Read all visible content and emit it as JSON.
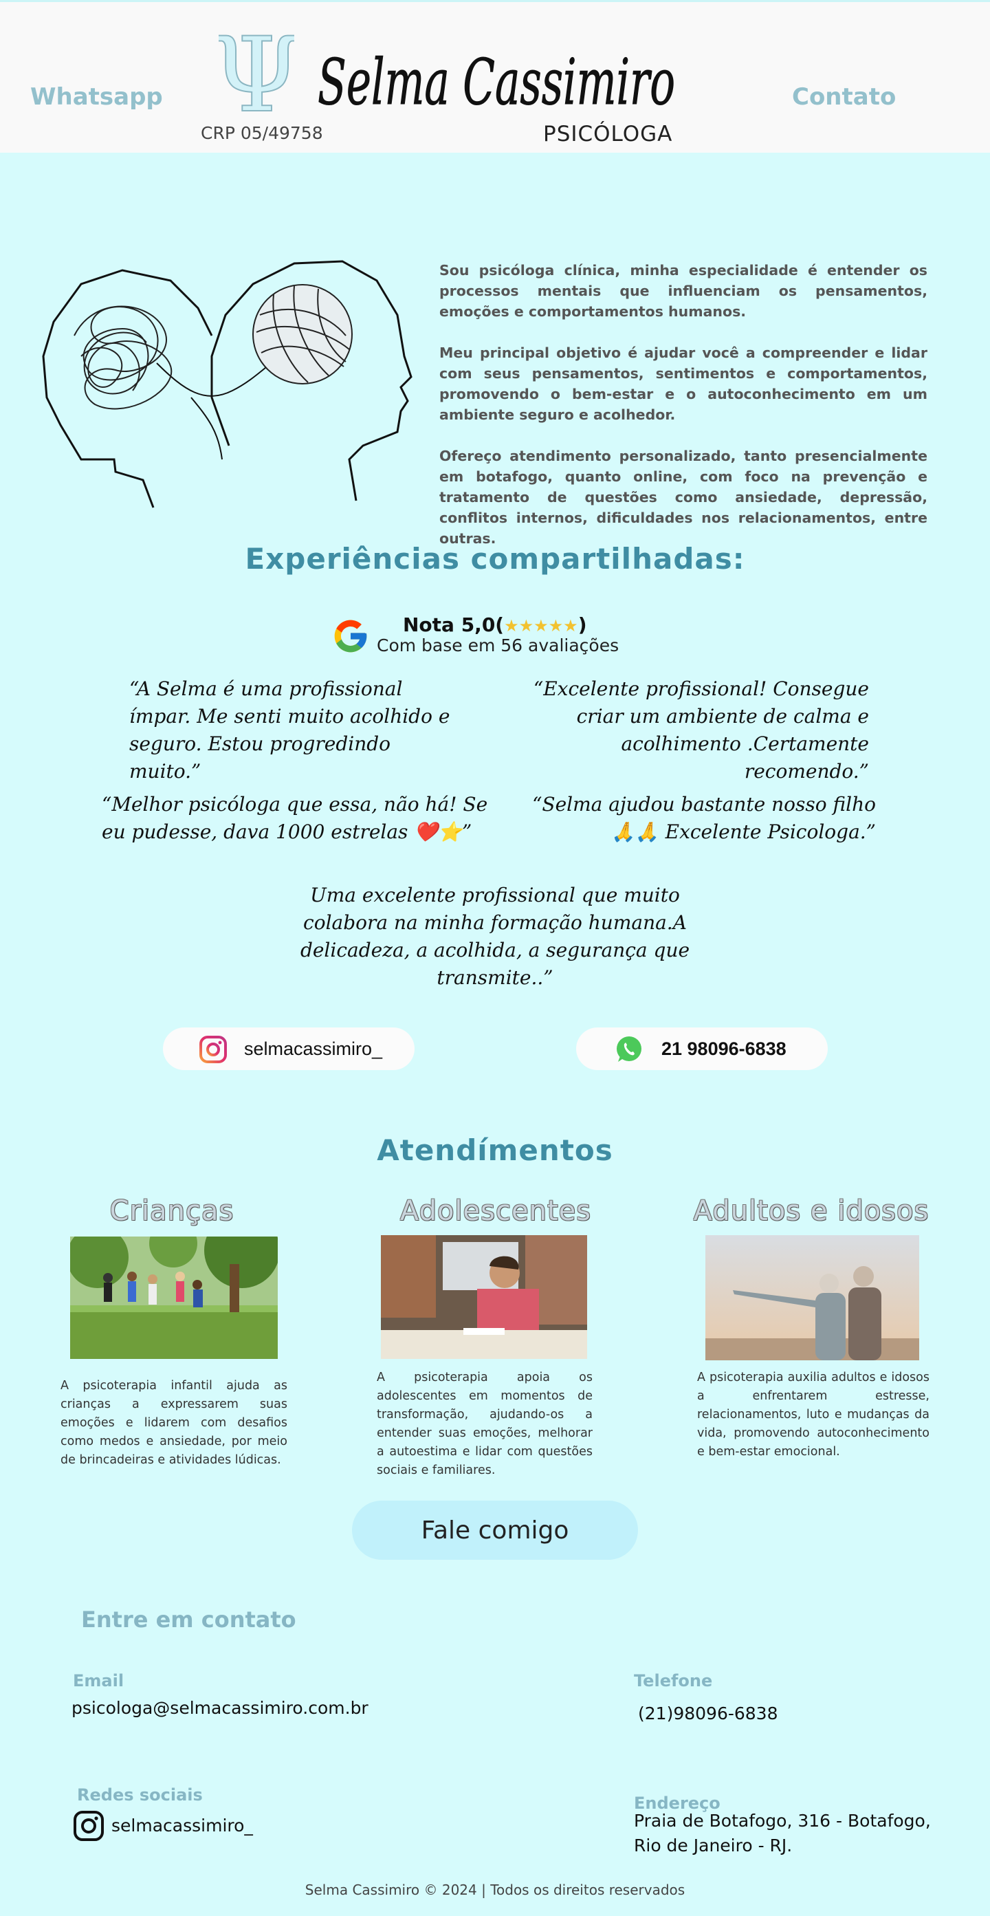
{
  "header": {
    "whatsapp_link": "Whatsapp",
    "contact_link": "Contato",
    "crp": "CRP 05/49758",
    "brand_name": "Selma Cassimiro",
    "role": "PSICÓLOGA",
    "psi_symbol": "Ψ"
  },
  "intro": {
    "p1": "Sou psicóloga clínica, minha especialidade é entender os processos mentais que influenciam os pensamentos, emoções e comportamentos humanos.",
    "p2": "Meu principal objetivo é ajudar você a compreender e lidar com seus pensamentos, sentimentos e comportamentos, promovendo o bem-estar e o autoconhecimento em um ambiente seguro e acolhedor.",
    "p3": "Ofereço atendimento personalizado, tanto presencialmente em botafogo, quanto online, com foco na prevenção e tratamento de questões como ansiedade, depressão, conflitos internos, dificuldades nos relacionamentos, entre outras."
  },
  "experiences": {
    "title": "Experiências compartilhadas:",
    "rating_title": "Nota 5,0(",
    "rating_stars": "★★★★★",
    "rating_close": ")",
    "rating_count": "Com base em 56 avaliações",
    "quotes": [
      "“A Selma é uma profissional ímpar. Me senti muito acolhido e seguro. Estou progredindo muito.”",
      "“Excelente profissional! Consegue criar um ambiente de calma e acolhimento .Certamente recomendo.”",
      "“Melhor psicóloga que essa, não há! Se eu pudesse, dava 1000 estrelas ❤️⭐”",
      "“Selma ajudou bastante nosso filho 🙏🙏 Excelente Psicologa.”",
      "Uma excelente profissional que muito colabora na minha formação humana.A delicadeza, a acolhida, a segurança que transmite..”"
    ]
  },
  "social": {
    "instagram": "selmacassimiro_",
    "whatsapp": "21 98096-6838"
  },
  "services": {
    "title": "Atendímentos",
    "items": [
      {
        "title": "Crianças",
        "desc": "A psicoterapia infantil ajuda as crianças a expressarem suas emoções e lidarem com desafios como medos e ansiedade, por meio de brincadeiras e atividades lúdicas."
      },
      {
        "title": "Adolescentes",
        "desc": "A psicoterapia apoia os adolescentes em momentos de transformação, ajudando-os a entender suas emoções, melhorar a autoestima e lidar com questões sociais e familiares."
      },
      {
        "title": "Adultos e idosos",
        "desc": "A psicoterapia auxilia adultos e idosos a enfrentarem estresse, relacionamentos, luto e mudanças da vida, promovendo autoconhecimento e bem-estar emocional."
      }
    ],
    "cta": "Fale comigo"
  },
  "contact": {
    "title": "Entre em contato",
    "email_label": "Email",
    "email": "psicologa@selmacassimiro.com.br",
    "phone_label": "Telefone",
    "phone": "(21)98096-6838",
    "social_label": "Redes sociais",
    "social_handle": "selmacassimiro_",
    "address_label": "Endereço",
    "address_line1": "Praia de Botafogo, 316 - Botafogo,",
    "address_line2": "Rio de Janeiro - RJ."
  },
  "footer": {
    "text": "Selma Cassimiro © 2024 | Todos os direitos reservados"
  },
  "colors": {
    "page_bg": "#d6fbfc",
    "header_bg": "#f9f9f9",
    "nav_link": "#93c0cc",
    "section_title": "#3f8da3",
    "cta_bg": "#c1f1fb"
  }
}
